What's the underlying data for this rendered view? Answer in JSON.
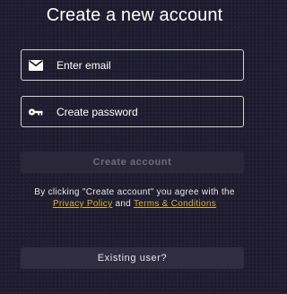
{
  "page": {
    "title": "Create a new account"
  },
  "form": {
    "email": {
      "placeholder": "Enter email",
      "value": "",
      "icon": "envelope-icon"
    },
    "password": {
      "placeholder": "Create password",
      "value": "",
      "icon": "key-icon"
    },
    "create_button_label": "Create account"
  },
  "terms": {
    "line1": "By clicking \"Create account\" you agree with the",
    "privacy_link": "Privacy Policy",
    "and_text": " and ",
    "terms_link": "Terms & Conditions"
  },
  "existing_user_label": "Existing user?",
  "colors": {
    "background": "#1f1d2f",
    "link": "#d8b23a",
    "disabled_button_bg": "#2a2838",
    "disabled_button_text": "#6e6c7a",
    "secondary_button_bg": "#2f2d3e",
    "field_border": "#cfcfd6"
  }
}
